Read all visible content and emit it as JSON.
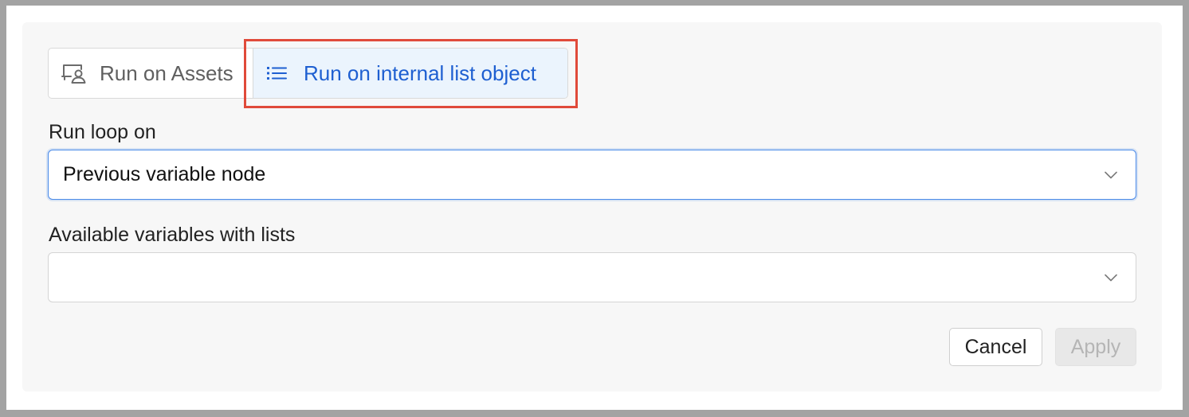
{
  "mode_selector": {
    "options": [
      {
        "label": "Run on Assets",
        "icon": "asset-user-icon",
        "selected": false
      },
      {
        "label": "Run on internal list object",
        "icon": "list-icon",
        "selected": true
      }
    ]
  },
  "run_loop_on": {
    "label": "Run loop on",
    "value": "Previous variable node"
  },
  "available_variables": {
    "label": "Available variables with lists",
    "value": ""
  },
  "actions": {
    "cancel_label": "Cancel",
    "apply_label": "Apply",
    "apply_enabled": false
  },
  "colors": {
    "accent": "#1e5fd1",
    "selected_bg": "#ebf4fd",
    "highlight": "#e04a3a",
    "focus_border": "#4a8ae8"
  }
}
